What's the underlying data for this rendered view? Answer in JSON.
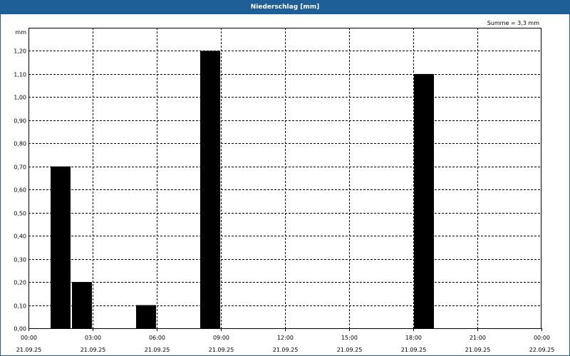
{
  "window": {
    "title": "Niederschlag [mm]"
  },
  "chart_data": {
    "type": "bar",
    "title": "Niederschlag [mm]",
    "ylabel": "mm",
    "xlabel": "",
    "annotation": "Summe = 3,3 mm",
    "ylim": [
      0,
      1.3
    ],
    "xlim_hours": [
      0,
      24
    ],
    "yticks": [
      "0,00",
      "0,10",
      "0,20",
      "0,30",
      "0,40",
      "0,50",
      "0,60",
      "0,70",
      "0,80",
      "0,90",
      "1,00",
      "1,10",
      "1,20"
    ],
    "xticks": [
      {
        "time": "00:00",
        "date": "21.09.25"
      },
      {
        "time": "03:00",
        "date": "21.09.25"
      },
      {
        "time": "06:00",
        "date": "21.09.25"
      },
      {
        "time": "09:00",
        "date": "21.09.25"
      },
      {
        "time": "12:00",
        "date": "21.09.25"
      },
      {
        "time": "15:00",
        "date": "21.09.25"
      },
      {
        "time": "18:00",
        "date": "21.09.25"
      },
      {
        "time": "21:00",
        "date": "21.09.25"
      },
      {
        "time": "00:00",
        "date": "22.09.25"
      }
    ],
    "bars": [
      {
        "start": "01:00",
        "end": "02:00",
        "value": 0.7
      },
      {
        "start": "02:00",
        "end": "03:00",
        "value": 0.2
      },
      {
        "start": "05:00",
        "end": "06:00",
        "value": 0.1
      },
      {
        "start": "08:00",
        "end": "09:00",
        "value": 1.2
      },
      {
        "start": "18:00",
        "end": "19:00",
        "value": 1.1
      }
    ],
    "bar_color": "#000000",
    "grid": true
  }
}
